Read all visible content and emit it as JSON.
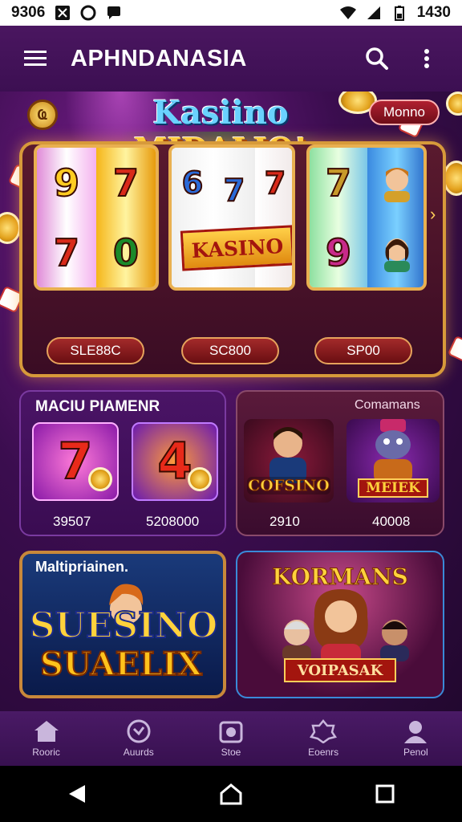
{
  "status_bar": {
    "left_time": "9306",
    "right_time": "1430"
  },
  "app_bar": {
    "title": "APHNDANASIA"
  },
  "machine": {
    "logo_line1": "Kasiino",
    "logo_line2": "MIDALIO!",
    "mode_label": "Monno",
    "badge": "Ҩ",
    "reel_ribbon": "KASINO",
    "reels": [
      {
        "symbols_left": [
          "9",
          "7"
        ],
        "symbols_right": [
          "7",
          "0"
        ],
        "button": "SLE88C"
      },
      {
        "symbols_left": [
          "6",
          "7"
        ],
        "symbols_right": [
          "7",
          ""
        ],
        "button": "SC800"
      },
      {
        "symbols_left": [
          "7",
          "9"
        ],
        "symbols_right": [
          "",
          ""
        ],
        "button": "SP00"
      }
    ]
  },
  "card_multipliers": {
    "title": "MACIU PIAMENR",
    "tiles": [
      {
        "symbol": "7",
        "value": "39507"
      },
      {
        "symbol": "4",
        "value": "5208000"
      }
    ]
  },
  "card_companions": {
    "title": "Comamans",
    "items": [
      {
        "badge": "COFSINO",
        "value": "2910"
      },
      {
        "badge": "MEIEK",
        "value": "40008"
      }
    ]
  },
  "card_super": {
    "title": "Maltipriainen.",
    "line1": "SUESINO",
    "line2": "SUAELIX"
  },
  "card_kormans": {
    "title": "KORMANS",
    "ribbon": "VOIPASAK"
  },
  "bottom_nav": [
    {
      "icon": "home-icon",
      "label": "Rooric"
    },
    {
      "icon": "awards-icon",
      "label": "Auurds"
    },
    {
      "icon": "store-icon",
      "label": "Stoe"
    },
    {
      "icon": "events-icon",
      "label": "Eoenrs"
    },
    {
      "icon": "profile-icon",
      "label": "Penol"
    }
  ],
  "colors": {
    "app_bar": "#4a1660",
    "gold": "#d79a3a",
    "accent_red": "#a32a2a"
  }
}
